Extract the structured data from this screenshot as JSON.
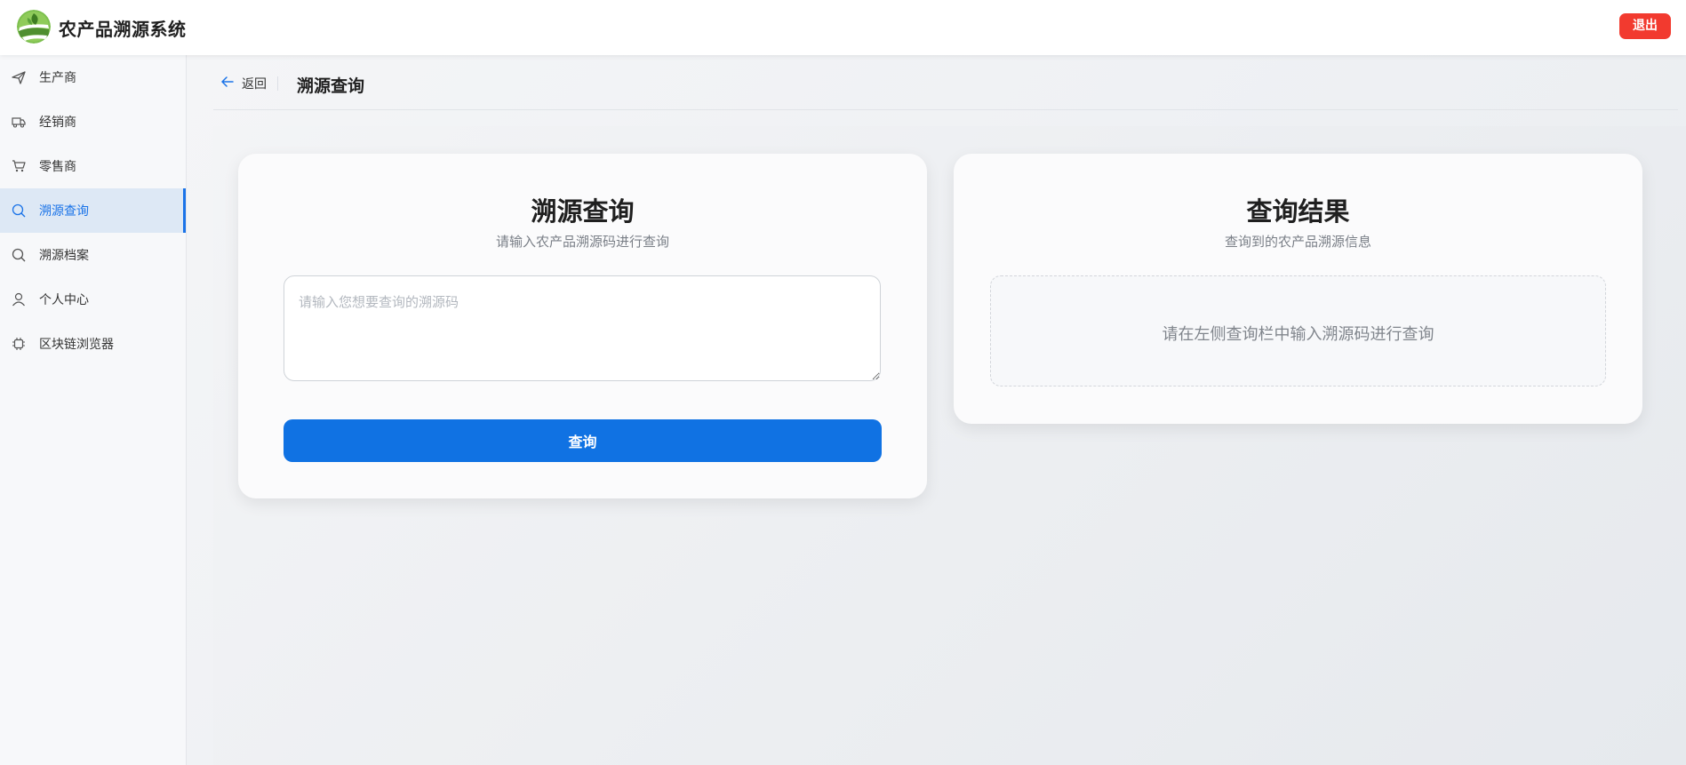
{
  "header": {
    "app_title": "农产品溯源系统",
    "logout_label": "退出"
  },
  "sidebar": {
    "items": [
      {
        "label": "生产商",
        "icon": "paper-plane-icon",
        "active": false
      },
      {
        "label": "经销商",
        "icon": "truck-icon",
        "active": false
      },
      {
        "label": "零售商",
        "icon": "cart-icon",
        "active": false
      },
      {
        "label": "溯源查询",
        "icon": "search-icon",
        "active": true
      },
      {
        "label": "溯源档案",
        "icon": "search-icon",
        "active": false
      },
      {
        "label": "个人中心",
        "icon": "user-icon",
        "active": false
      },
      {
        "label": "区块链浏览器",
        "icon": "chip-icon",
        "active": false
      }
    ]
  },
  "page_header": {
    "back_label": "返回",
    "title": "溯源查询"
  },
  "query_card": {
    "title": "溯源查询",
    "subtitle": "请输入农产品溯源码进行查询",
    "input_placeholder": "请输入您想要查询的溯源码",
    "input_value": "",
    "button_label": "查询"
  },
  "result_card": {
    "title": "查询结果",
    "subtitle": "查询到的农产品溯源信息",
    "empty_text": "请在左侧查询栏中输入溯源码进行查询"
  },
  "colors": {
    "accent": "#1072e3",
    "active_nav_text": "#1a73e8",
    "active_nav_bg": "#dde8f5",
    "logout": "#f23a2f",
    "logo_green": "#6ab04c"
  }
}
